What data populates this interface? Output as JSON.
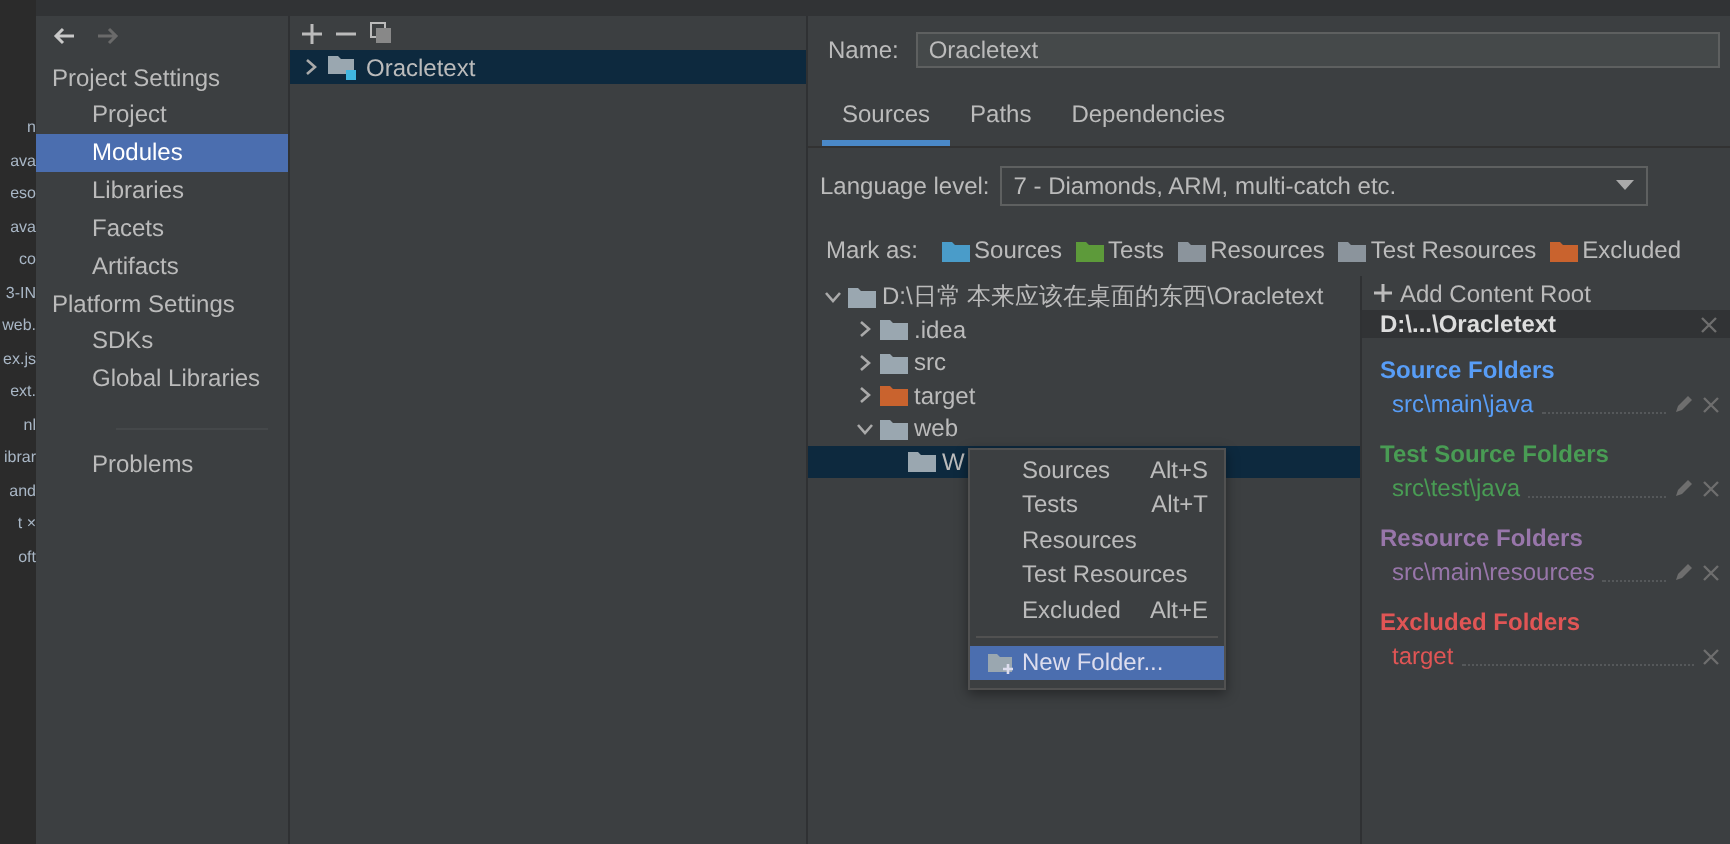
{
  "background_editor": {
    "lines": [
      "n",
      "ava",
      "eso",
      "ava",
      "co",
      "3-IN",
      "web.",
      "ex.js",
      "ext.",
      "nl",
      "ibrar",
      "and",
      "t ×",
      "oft"
    ]
  },
  "sidebar": {
    "sections": [
      {
        "title": "Project Settings",
        "items": [
          {
            "label": "Project",
            "selected": false
          },
          {
            "label": "Modules",
            "selected": true
          },
          {
            "label": "Libraries",
            "selected": false
          },
          {
            "label": "Facets",
            "selected": false
          },
          {
            "label": "Artifacts",
            "selected": false
          }
        ]
      },
      {
        "title": "Platform Settings",
        "items": [
          {
            "label": "SDKs",
            "selected": false
          },
          {
            "label": "Global Libraries",
            "selected": false
          }
        ]
      }
    ],
    "extra_items": [
      {
        "label": "Problems",
        "selected": false
      }
    ]
  },
  "modules": {
    "tree": [
      {
        "label": "Oracletext",
        "expanded": false,
        "selected": true
      }
    ]
  },
  "module": {
    "name_label": "Name:",
    "name": "Oracletext",
    "tabs": [
      {
        "label": "Sources",
        "selected": true
      },
      {
        "label": "Paths",
        "selected": false
      },
      {
        "label": "Dependencies",
        "selected": false
      }
    ],
    "language_level_label": "Language level:",
    "language_level": "7 - Diamonds, ARM, multi-catch etc.",
    "mark_as_label": "Mark as:",
    "mark_as": [
      {
        "label": "Sources",
        "color": "#4a9cc9"
      },
      {
        "label": "Tests",
        "color": "#5d9a3a"
      },
      {
        "label": "Resources",
        "color": "#8b949c"
      },
      {
        "label": "Test Resources",
        "color": "#8b949c"
      },
      {
        "label": "Excluded",
        "color": "#c9632e"
      }
    ]
  },
  "tree": [
    {
      "label": "D:\\日常 本来应该在桌面的东西\\Oracletext",
      "color": "#9aa7b0",
      "expanded": true,
      "selected": false,
      "children": [
        {
          "label": ".idea",
          "color": "#9aa7b0",
          "expanded": false,
          "selected": false
        },
        {
          "label": "src",
          "color": "#9aa7b0",
          "expanded": false,
          "selected": false
        },
        {
          "label": "target",
          "color": "#c9632e",
          "expanded": false,
          "selected": false
        },
        {
          "label": "web",
          "color": "#9aa7b0",
          "expanded": true,
          "selected": false,
          "children": [
            {
              "label": "W",
              "color": "#9aa7b0",
              "selected": true
            }
          ]
        }
      ]
    }
  ],
  "context_menu": {
    "items": [
      {
        "label": "Sources",
        "shortcut": "Alt+S"
      },
      {
        "label": "Tests",
        "shortcut": "Alt+T"
      },
      {
        "label": "Resources"
      },
      {
        "label": "Test Resources"
      },
      {
        "label": "Excluded",
        "shortcut": "Alt+E"
      }
    ],
    "actions": [
      {
        "label": "New Folder...",
        "selected": true
      }
    ]
  },
  "content_roots": {
    "add_label": "Add Content Root",
    "root": "D:\\...\\Oracletext",
    "groups": [
      {
        "title": "Source Folders",
        "color": "#589df6",
        "folders": [
          {
            "path": "src\\main\\java",
            "editable": true
          }
        ]
      },
      {
        "title": "Test Source Folders",
        "color": "#499c54",
        "folders": [
          {
            "path": "src\\test\\java",
            "editable": true
          }
        ]
      },
      {
        "title": "Resource Folders",
        "color": "#9876aa",
        "folders": [
          {
            "path": "src\\main\\resources",
            "editable": true
          }
        ]
      },
      {
        "title": "Excluded Folders",
        "color": "#e05555",
        "folders": [
          {
            "path": "target",
            "editable": false
          }
        ]
      }
    ]
  }
}
